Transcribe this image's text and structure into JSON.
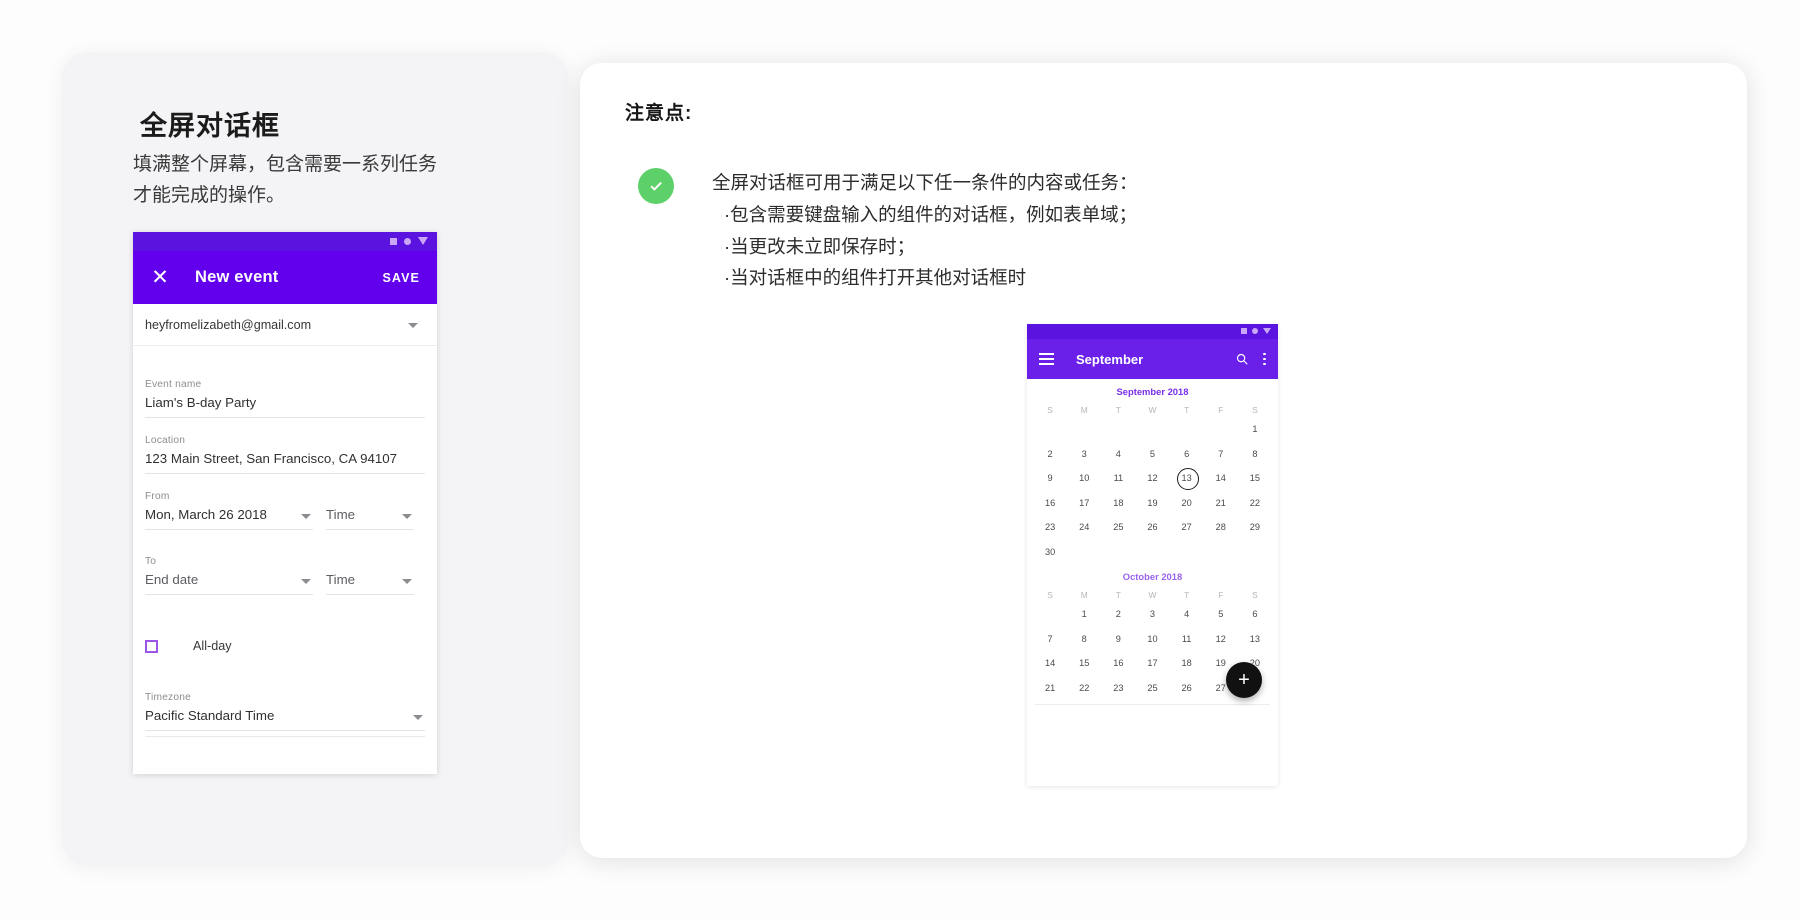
{
  "left_panel": {
    "title": "全屏对话框",
    "subtitle": "填满整个屏幕，包含需要一系列任务才能完成的操作。"
  },
  "event_dialog": {
    "status_icons": [
      "square-icon",
      "circle-icon",
      "triangle-icon"
    ],
    "close_icon": "✕",
    "title": "New event",
    "save_label": "SAVE",
    "account": "heyfromelizabeth@gmail.com",
    "fields": {
      "event_name": {
        "label": "Event name",
        "value": "Liam's B-day Party"
      },
      "location": {
        "label": "Location",
        "value": "123 Main Street, San Francisco, CA 94107"
      },
      "from": {
        "label": "From",
        "value": "Mon, March 26 2018",
        "time_placeholder": "Time"
      },
      "to": {
        "label": "To",
        "value": "End date",
        "time_placeholder": "Time"
      },
      "all_day": {
        "label": "All-day",
        "checked": false
      },
      "timezone": {
        "label": "Timezone",
        "value": "Pacific Standard Time"
      }
    },
    "accent_color": "#6200ee",
    "statusbar_color": "#5b13e0",
    "checkbox_color": "#9b56e8"
  },
  "right_panel": {
    "heading": "注意点:",
    "badge_icon": "check-circle-icon",
    "badge_color": "#5ed06a",
    "notes": {
      "lead": "全屏对话框可用于满足以下任一条件的内容或任务：",
      "bullets": [
        "·包含需要键盘输入的组件的对话框，例如表单域；",
        "·当更改未立即保存时；",
        "·当对话框中的组件打开其他对话框时"
      ]
    }
  },
  "calendar": {
    "status_icons": [
      "square-icon",
      "circle-icon",
      "triangle-icon"
    ],
    "menu_icon": "hamburger-icon",
    "title": "September",
    "search_icon": "search-icon",
    "overflow_icon": "more-vert-icon",
    "fab_label": "+",
    "accent_color": "#6a20e8",
    "dow": [
      "S",
      "M",
      "T",
      "W",
      "T",
      "F",
      "S"
    ],
    "months": [
      {
        "label": "September  2018",
        "cells": [
          "",
          "",
          "",
          "",
          "",
          "",
          "1",
          "2",
          "3",
          "4",
          "5",
          "6",
          "7",
          "8",
          "9",
          "10",
          "11",
          "12",
          "13",
          "14",
          "15",
          "16",
          "17",
          "18",
          "19",
          "20",
          "21",
          "22",
          "23",
          "24",
          "25",
          "26",
          "27",
          "28",
          "29",
          "30",
          "",
          "",
          "",
          "",
          "",
          ""
        ],
        "today": "13"
      },
      {
        "label": "October  2018",
        "cells": [
          "",
          "1",
          "2",
          "3",
          "4",
          "5",
          "6",
          "7",
          "8",
          "9",
          "10",
          "11",
          "12",
          "13",
          "14",
          "15",
          "16",
          "17",
          "18",
          "19",
          "20",
          "21",
          "22",
          "23",
          "25",
          "26",
          "27",
          ""
        ],
        "today": ""
      }
    ]
  }
}
